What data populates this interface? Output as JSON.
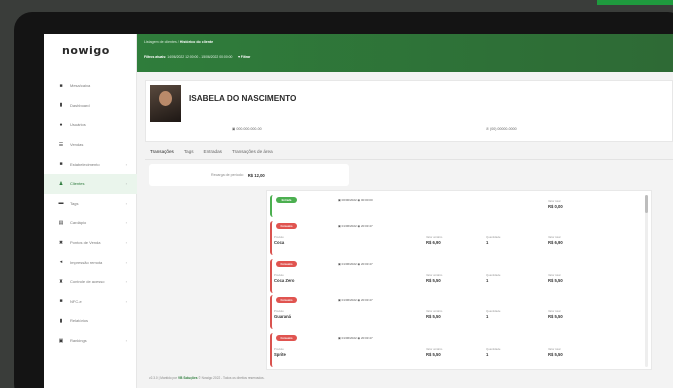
{
  "app": {
    "logo": "nowigo"
  },
  "sidebar": {
    "items": [
      {
        "label": "Mesa/caixa",
        "icon": "■",
        "chev": ""
      },
      {
        "label": "Dashboard",
        "icon": "▮",
        "chev": ""
      },
      {
        "label": "Usuários",
        "icon": "●",
        "chev": ""
      },
      {
        "label": "Vendas",
        "icon": "☰",
        "chev": ""
      },
      {
        "label": "Estabelecimento",
        "icon": "■",
        "chev": "›"
      },
      {
        "label": "Clientes",
        "icon": "♟",
        "chev": "›"
      },
      {
        "label": "Tags",
        "icon": "▬",
        "chev": "›"
      },
      {
        "label": "Cardápio",
        "icon": "▤",
        "chev": "›"
      },
      {
        "label": "Pontos de Venda",
        "icon": "✖",
        "chev": "›"
      },
      {
        "label": "Impressão remota",
        "icon": "◂",
        "chev": "›"
      },
      {
        "label": "Controle de acesso",
        "icon": "♜",
        "chev": "›"
      },
      {
        "label": "NFC-e",
        "icon": "■",
        "chev": "›"
      },
      {
        "label": "Relatórios",
        "icon": "▮",
        "chev": ""
      },
      {
        "label": "Rankings",
        "icon": "▣",
        "chev": "›"
      }
    ]
  },
  "header": {
    "breadcrumb_prefix": "Listagem de clientes /",
    "breadcrumb_current": "Histórico do cliente",
    "filters_label": "Filtros atuais:",
    "filters_value": "14/06/2022 12:00:00 - 15/06/2022 00:00:00",
    "filter_button": "▼Filtrar"
  },
  "client": {
    "name": "ISABELA DO NASCIMENTO",
    "document": "▣ 000.000.000-00",
    "phone": "✆ (00) 00000-0000"
  },
  "tabs": [
    "Transações",
    "Tags",
    "Entradas",
    "Transações de área"
  ],
  "balance": {
    "label": "Recarga de período:",
    "value": "R$ 12,00"
  },
  "transactions": [
    {
      "type": "credit",
      "badge": "Entrada",
      "meta": "▣ 00/00/2022 ◉ 00:00:00",
      "total_label": "Valor total",
      "total": "R$ 0,00",
      "product": "",
      "unit": "",
      "qty": ""
    },
    {
      "type": "debit",
      "badge": "Consumo",
      "meta": "▣ 01/06/2022 ◉ 20:03:47",
      "product_label": "Produto",
      "product": "Coca",
      "unit_label": "Valor unitário",
      "unit": "R$ 6,90",
      "qty_label": "Quantidade",
      "qty": "1",
      "total_label": "Valor total",
      "total": "R$ 6,90"
    },
    {
      "type": "debit",
      "badge": "Consumo",
      "meta": "▣ 01/06/2022 ◉ 20:03:47",
      "product_label": "Produto",
      "product": "Coca Zero",
      "unit_label": "Valor unitário",
      "unit": "R$ 5,50",
      "qty_label": "Quantidade",
      "qty": "1",
      "total_label": "Valor total",
      "total": "R$ 5,50"
    },
    {
      "type": "debit",
      "badge": "Consumo",
      "meta": "▣ 01/06/2022 ◉ 20:03:47",
      "product_label": "Produto",
      "product": "Guaraná",
      "unit_label": "Valor unitário",
      "unit": "R$ 5,50",
      "qty_label": "Quantidade",
      "qty": "1",
      "total_label": "Valor total",
      "total": "R$ 5,50"
    },
    {
      "type": "debit",
      "badge": "Consumo",
      "meta": "▣ 01/06/2022 ◉ 20:03:47",
      "product_label": "Produto",
      "product": "Sprite",
      "unit_label": "Valor unitário",
      "unit": "R$ 5,50",
      "qty_label": "Quantidade",
      "qty": "1",
      "total_label": "Valor total",
      "total": "R$ 5,50"
    }
  ],
  "footer": {
    "prefix": "v2.3.0 | Mantido por",
    "brand1": "VB Soluções",
    "middle": "© Nowigo 2022 - Todos os direitos reservados."
  },
  "colors": {
    "primary": "#2f7d3b",
    "credit": "#4caf50",
    "debit": "#e05450"
  }
}
